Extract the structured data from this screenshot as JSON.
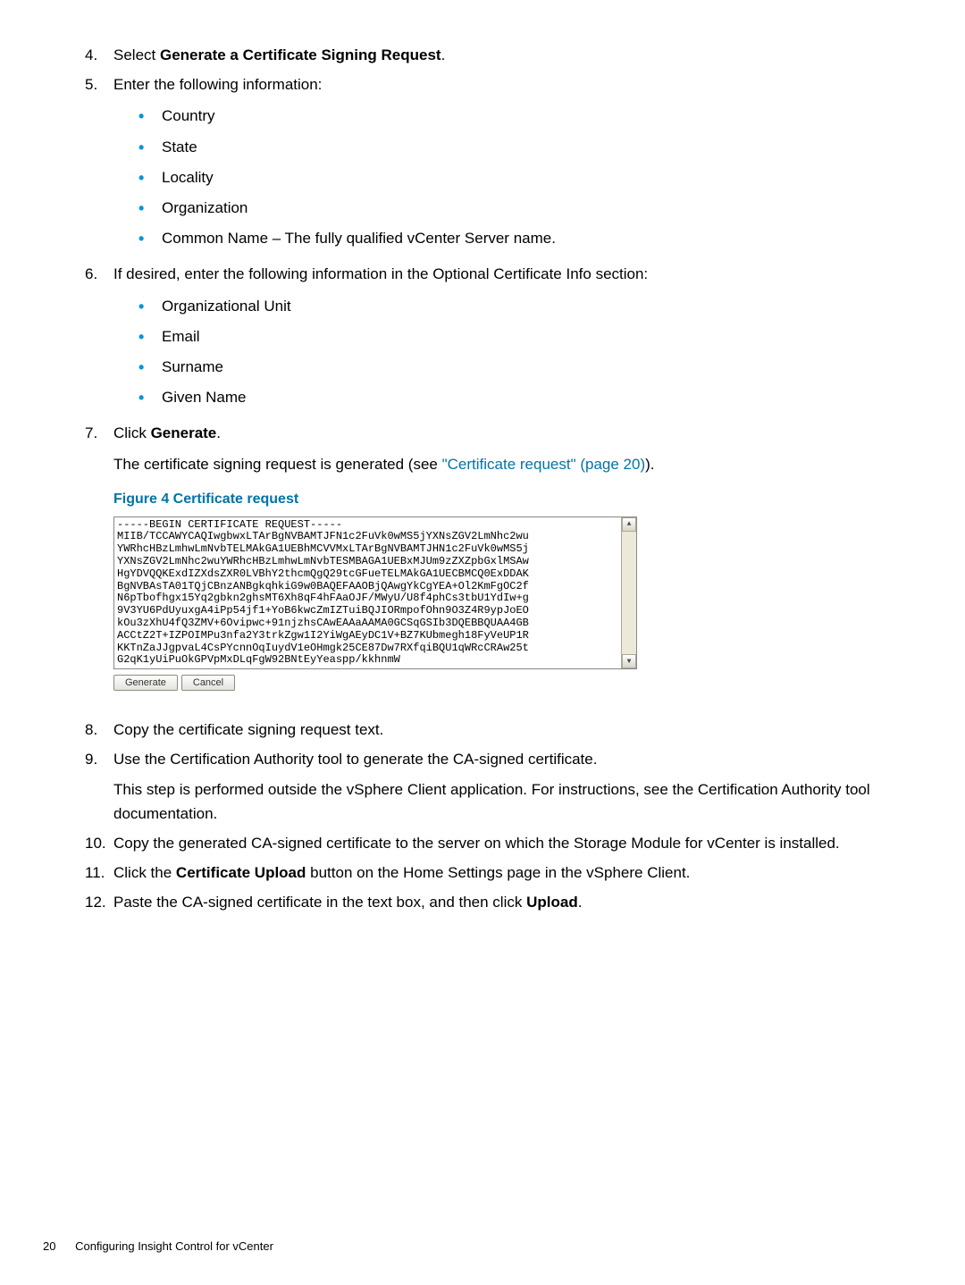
{
  "steps": {
    "s4": {
      "num": "4.",
      "prefix": "Select ",
      "bold": "Generate a Certificate Signing Request",
      "suffix": "."
    },
    "s5": {
      "num": "5.",
      "text": "Enter the following information:",
      "bullets": [
        "Country",
        "State",
        "Locality",
        "Organization",
        "Common Name – The fully qualified vCenter Server name."
      ]
    },
    "s6": {
      "num": "6.",
      "text": "If desired, enter the following information in the Optional Certificate Info section:",
      "bullets": [
        "Organizational Unit",
        "Email",
        "Surname",
        "Given Name"
      ]
    },
    "s7": {
      "num": "7.",
      "prefix": "Click ",
      "bold": "Generate",
      "suffix": ".",
      "desc_prefix": "The certificate signing request is generated (see ",
      "desc_link": "\"Certificate request\" (page 20)",
      "desc_suffix": ")."
    }
  },
  "figure": {
    "label": "Figure 4 Certificate request",
    "text": "-----BEGIN CERTIFICATE REQUEST-----\nMIIB/TCCAWYCAQIwgbwxLTArBgNVBAMTJFN1c2FuVk0wMS5jYXNsZGV2LmNhc2wu\nYWRhcHBzLmhwLmNvbTELMAkGA1UEBhMCVVMxLTArBgNVBAMTJHN1c2FuVk0wMS5j\nYXNsZGV2LmNhc2wuYWRhcHBzLmhwLmNvbTESMBAGA1UEBxMJUm9zZXZpbGxlMSAw\nHgYDVQQKExdIZXdsZXR0LVBhY2thcmQgQ29tcGFueTELMAkGA1UECBMCQ0ExDDAK\nBgNVBAsTA01TQjCBnzANBgkqhkiG9w0BAQEFAAOBjQAwgYkCgYEA+Ol2KmFgOC2f\nN6pTbofhgx15Yq2gbkn2ghsMT6Xh8qF4hFAaOJF/MWyU/U8f4phCs3tbU1YdIw+g\n9V3YU6PdUyuxgA4iPp54jf1+YoB6kwcZmIZTuiBQJIORmpofOhn9O3Z4R9ypJoEO\nkOu3zXhU4fQ3ZMV+6Ovipwc+91njzhsCAwEAAaAAMA0GCSqGSIb3DQEBBQUAA4GB\nACCtZ2T+IZPOIMPu3nfa2Y3trkZgw1I2YiWgAEyDC1V+BZ7KUbmegh18FyVeUP1R\nKKTnZaJJgpvaL4CsPYcnnOqIuydV1eOHmgk25CE87Dw7RXfqiBQU1qWRcCRAw25t\nG2qK1yUiPuOkGPVpMxDLqFgW92BNtEyYeaspp/kkhnmW",
    "btn_generate": "Generate",
    "btn_cancel": "Cancel"
  },
  "steps2": {
    "s8": {
      "num": "8.",
      "text": "Copy the certificate signing request text."
    },
    "s9": {
      "num": "9.",
      "text": "Use the Certification Authority tool to generate the CA-signed certificate.",
      "desc": "This step is performed outside the vSphere Client application. For instructions, see the Certification Authority tool documentation."
    },
    "s10": {
      "num": "10.",
      "text": "Copy the generated CA-signed certificate to the server on which the Storage Module for vCenter is installed."
    },
    "s11": {
      "num": "11.",
      "prefix": "Click the ",
      "bold": "Certificate Upload",
      "suffix": " button on the Home Settings page in the vSphere Client."
    },
    "s12": {
      "num": "12.",
      "prefix": "Paste the CA-signed certificate in the text box, and then click ",
      "bold": "Upload",
      "suffix": "."
    }
  },
  "footer": {
    "page": "20",
    "title": "Configuring Insight Control for vCenter"
  }
}
